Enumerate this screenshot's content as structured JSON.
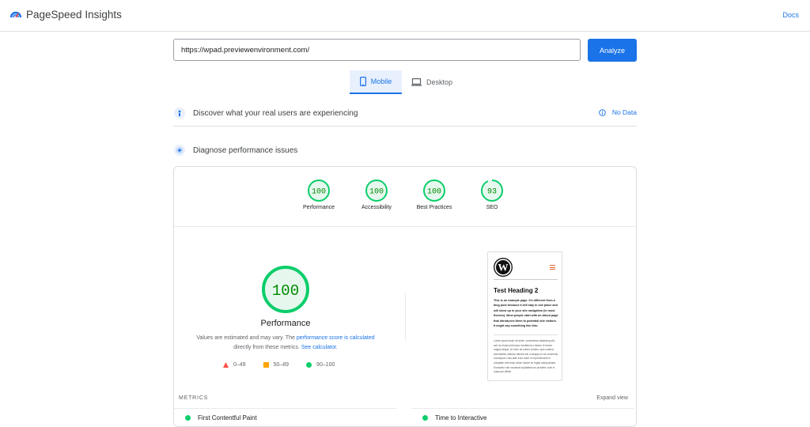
{
  "header": {
    "brand": "PageSpeed Insights",
    "docs_label": "Docs",
    "logo_icon": "pagespeed-logo-icon"
  },
  "search": {
    "url_value": "https://wpad.previewenvironment.com/",
    "analyze_label": "Analyze"
  },
  "tabs": [
    {
      "label": "Mobile",
      "icon": "mobile-icon",
      "selected": true
    },
    {
      "label": "Desktop",
      "icon": "desktop-icon",
      "selected": false
    }
  ],
  "sections": {
    "field": {
      "title": "Discover what your real users are experiencing",
      "status": "No Data"
    },
    "lab": {
      "title": "Diagnose performance issues"
    }
  },
  "scores": [
    {
      "label": "Performance",
      "value": "100",
      "fraction": 1.0
    },
    {
      "label": "Accessibility",
      "value": "100",
      "fraction": 1.0
    },
    {
      "label": "Best Practices",
      "value": "100",
      "fraction": 1.0
    },
    {
      "label": "SEO",
      "value": "93",
      "fraction": 0.93
    }
  ],
  "performance": {
    "score": "100",
    "title": "Performance",
    "desc_prefix": "Values are estimated and may vary. The ",
    "desc_link": "performance score is calculated",
    "desc_middle": "directly from these metrics. ",
    "desc_link2": "See calculator."
  },
  "legend": [
    {
      "range": "0–49",
      "shape": "triangle",
      "color": "#ff4e42"
    },
    {
      "range": "50–89",
      "shape": "square",
      "color": "#ffa400"
    },
    {
      "range": "90–100",
      "shape": "circle",
      "color": "#0cce6b"
    }
  ],
  "preview": {
    "heading": "Test Heading 2",
    "paragraph": "This is an example page. It's different from a blog post because it will stay in one place and will show up in your site navigation (in most themes). Most people start with an About page that introduces them to potential site visitors. It might say something like this:",
    "quote": "Lorem ipsum dolor sit amet, consectetur adipiscing elit, sed do eiusmod tempor incididunt ut labore et dolore magna aliqua. Ut enim ad minim veniam, quis nostrud exercitation ullamco laboris nisi ut aliquip ex ea commodo consequat. Duis aute irure dolor in reprehenderit in voluptate velit esse cillum dolore eu fugiat nulla pariatur. Excepteur sint occaecat cupidatat non proident, sunt in culpa qui officia"
  },
  "metrics": {
    "label": "METRICS",
    "expand_label": "Expand view",
    "items": [
      "First Contentful Paint",
      "Time to Interactive"
    ]
  },
  "colors": {
    "accent": "#1a73e8",
    "pass": "#0cce6b",
    "pass_text": "#008800",
    "pass_bg": "#e6f8ee"
  }
}
